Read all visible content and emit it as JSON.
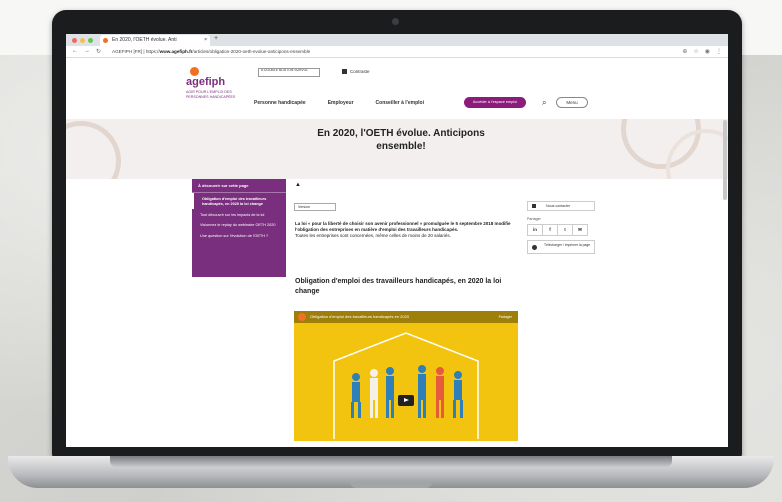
{
  "browser": {
    "tab_title": "En 2020, l'OETH évolue. Anti",
    "tab_close": "×",
    "new_tab": "+",
    "url_prefix": "AGEFIPH [FR] | https://",
    "url_domain": "www.agefiph.fr",
    "url_path": "/articles/obligation-2020-oeth-evolue-anticipons-ensemble"
  },
  "site": {
    "logo_text": "agefiph",
    "logo_sub": "AGIR POUR L'EMPLOI DES PERSONNES HANDICAPÉES",
    "a11y_box": "A DOUBLE BOUTON SURVOL",
    "contrast_label": "Contraste",
    "nav": [
      "Personne handicapée",
      "Employeur",
      "Conseiller à l'emploi"
    ],
    "cta": "Accéder à l'espace emploi",
    "menu_label": "Menu"
  },
  "hero": {
    "title": "En 2020, l'OETH évolue. Anticipons ensemble!"
  },
  "sidebar": {
    "heading": "À découvrir sur cette page",
    "items": [
      "Obligation d'emploi des travailleurs handicapés, en 2020 la loi change",
      "Tout découvrir sur les impacts de la loi",
      "Visionnez le replay du webinaire OETH 2020",
      "Une question sur l'évolution de l'OETH ?"
    ]
  },
  "content": {
    "lang_pill": "Version",
    "intro_bold": "La loi « pour la liberté de choisir son avenir professionnel » promulguée le 5 septembre 2018 modifie l'obligation des entreprises en matière d'emploi des travailleurs handicapés.",
    "intro_rest": "Toutes les entreprises sont concernées, même celles de moins de 20 salariés.",
    "h2": "Obligation d'emploi des travailleurs handicapés, en 2020 la loi change",
    "video_title": "Obligation d'emploi des travailleurs handicapés en 2020",
    "video_right": "Partager"
  },
  "rail": {
    "contact": "Nous contacter",
    "share_label": "Partager",
    "social": [
      "in",
      "f",
      "t",
      "✉"
    ],
    "download": "Télécharger / imprimer la page"
  },
  "colors": {
    "brand_purple": "#7a2e7e",
    "brand_orange": "#f36f21",
    "video_yellow": "#f2c40f",
    "cta": "#8b1c7c"
  }
}
